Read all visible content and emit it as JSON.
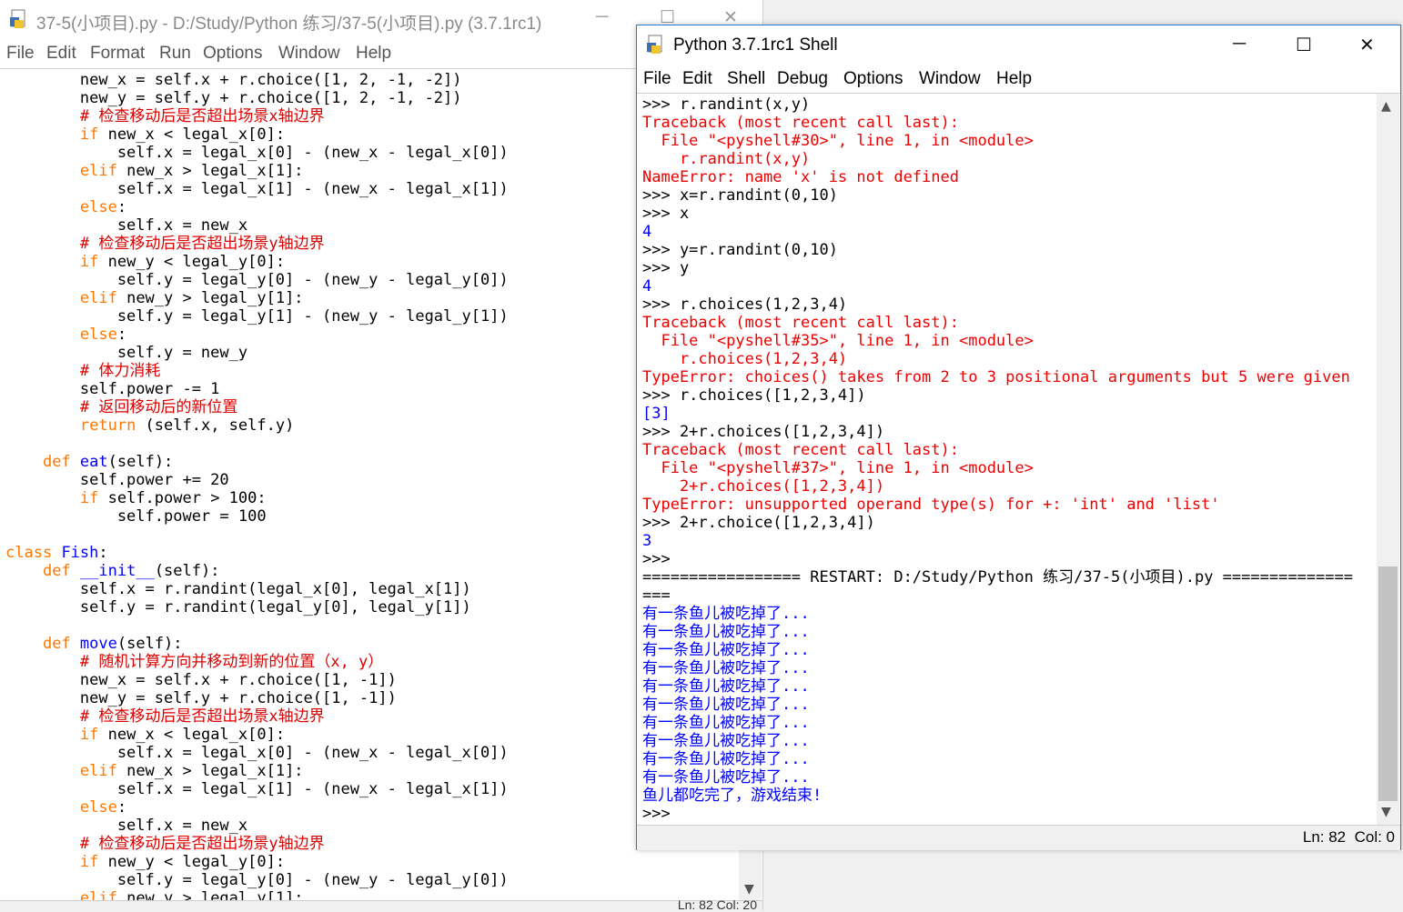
{
  "editor": {
    "title": "37-5(小项目).py - D:/Study/Python 练习/37-5(小项目).py (3.7.1rc1)",
    "menu": [
      "File",
      "Edit",
      "Format",
      "Run",
      "Options",
      "Window",
      "Help"
    ],
    "status": "Ln: 82  Col: 20",
    "code_lines": [
      [
        [
          "        new_x = self.x + r.choice([1, 2, -1, -2])",
          "n"
        ]
      ],
      [
        [
          "        new_y = self.y + r.choice([1, 2, -1, -2])",
          "n"
        ]
      ],
      [
        [
          "        # 检查移动后是否超出场景x轴边界",
          "c"
        ]
      ],
      [
        [
          "        ",
          "n"
        ],
        [
          "if",
          "k"
        ],
        [
          " new_x < legal_x[0]:",
          "n"
        ]
      ],
      [
        [
          "            self.x = legal_x[0] - (new_x - legal_x[0])",
          "n"
        ]
      ],
      [
        [
          "        ",
          "n"
        ],
        [
          "elif",
          "k"
        ],
        [
          " new_x > legal_x[1]:",
          "n"
        ]
      ],
      [
        [
          "            self.x = legal_x[1] - (new_x - legal_x[1])",
          "n"
        ]
      ],
      [
        [
          "        ",
          "n"
        ],
        [
          "else",
          "k"
        ],
        [
          ":",
          "n"
        ]
      ],
      [
        [
          "            self.x = new_x",
          "n"
        ]
      ],
      [
        [
          "        # 检查移动后是否超出场景y轴边界",
          "c"
        ]
      ],
      [
        [
          "        ",
          "n"
        ],
        [
          "if",
          "k"
        ],
        [
          " new_y < legal_y[0]:",
          "n"
        ]
      ],
      [
        [
          "            self.y = legal_y[0] - (new_y - legal_y[0])",
          "n"
        ]
      ],
      [
        [
          "        ",
          "n"
        ],
        [
          "elif",
          "k"
        ],
        [
          " new_y > legal_y[1]:",
          "n"
        ]
      ],
      [
        [
          "            self.y = legal_y[1] - (new_y - legal_y[1])",
          "n"
        ]
      ],
      [
        [
          "        ",
          "n"
        ],
        [
          "else",
          "k"
        ],
        [
          ":",
          "n"
        ]
      ],
      [
        [
          "            self.y = new_y",
          "n"
        ]
      ],
      [
        [
          "        # 体力消耗",
          "c"
        ]
      ],
      [
        [
          "        self.power -= 1",
          "n"
        ]
      ],
      [
        [
          "        # 返回移动后的新位置",
          "c"
        ]
      ],
      [
        [
          "        ",
          "n"
        ],
        [
          "return",
          "k"
        ],
        [
          " (self.x, self.y)",
          "n"
        ]
      ],
      [
        [
          "",
          "n"
        ]
      ],
      [
        [
          "    ",
          "n"
        ],
        [
          "def",
          "k"
        ],
        [
          " ",
          "n"
        ],
        [
          "eat",
          "d"
        ],
        [
          "(self):",
          "n"
        ]
      ],
      [
        [
          "        self.power += 20",
          "n"
        ]
      ],
      [
        [
          "        ",
          "n"
        ],
        [
          "if",
          "k"
        ],
        [
          " self.power > 100:",
          "n"
        ]
      ],
      [
        [
          "            self.power = 100",
          "n"
        ]
      ],
      [
        [
          "",
          "n"
        ]
      ],
      [
        [
          "class",
          "k"
        ],
        [
          " ",
          "n"
        ],
        [
          "Fish",
          "d"
        ],
        [
          ":",
          "n"
        ]
      ],
      [
        [
          "    ",
          "n"
        ],
        [
          "def",
          "k"
        ],
        [
          " ",
          "n"
        ],
        [
          "__init__",
          "d"
        ],
        [
          "(self):",
          "n"
        ]
      ],
      [
        [
          "        self.x = r.randint(legal_x[0], legal_x[1])",
          "n"
        ]
      ],
      [
        [
          "        self.y = r.randint(legal_y[0], legal_y[1])",
          "n"
        ]
      ],
      [
        [
          "",
          "n"
        ]
      ],
      [
        [
          "    ",
          "n"
        ],
        [
          "def",
          "k"
        ],
        [
          " ",
          "n"
        ],
        [
          "move",
          "d"
        ],
        [
          "(self):",
          "n"
        ]
      ],
      [
        [
          "        # 随机计算方向并移动到新的位置（x, y）",
          "c"
        ]
      ],
      [
        [
          "        new_x = self.x + r.choice([1, -1])",
          "n"
        ]
      ],
      [
        [
          "        new_y = self.y + r.choice([1, -1])",
          "n"
        ]
      ],
      [
        [
          "        # 检查移动后是否超出场景x轴边界",
          "c"
        ]
      ],
      [
        [
          "        ",
          "n"
        ],
        [
          "if",
          "k"
        ],
        [
          " new_x < legal_x[0]:",
          "n"
        ]
      ],
      [
        [
          "            self.x = legal_x[0] - (new_x - legal_x[0])",
          "n"
        ]
      ],
      [
        [
          "        ",
          "n"
        ],
        [
          "elif",
          "k"
        ],
        [
          " new_x > legal_x[1]:",
          "n"
        ]
      ],
      [
        [
          "            self.x = legal_x[1] - (new_x - legal_x[1])",
          "n"
        ]
      ],
      [
        [
          "        ",
          "n"
        ],
        [
          "else",
          "k"
        ],
        [
          ":",
          "n"
        ]
      ],
      [
        [
          "            self.x = new_x",
          "n"
        ]
      ],
      [
        [
          "        # 检查移动后是否超出场景y轴边界",
          "c"
        ]
      ],
      [
        [
          "        ",
          "n"
        ],
        [
          "if",
          "k"
        ],
        [
          " new_y < legal_y[0]:",
          "n"
        ]
      ],
      [
        [
          "            self.y = legal_y[0] - (new_y - legal_y[0])",
          "n"
        ]
      ],
      [
        [
          "        ",
          "n"
        ],
        [
          "elif",
          "k"
        ],
        [
          " new_y > legal_y[1]:",
          "n"
        ]
      ]
    ]
  },
  "shell": {
    "title": "Python 3.7.1rc1 Shell",
    "menu": [
      "File",
      "Edit",
      "Shell",
      "Debug",
      "Options",
      "Window",
      "Help"
    ],
    "status": "Ln: 82  Col: 0",
    "lines": [
      [
        [
          ">>> r.randint(x,y)",
          "n"
        ]
      ],
      [
        [
          "Traceback (most recent call last):",
          "e"
        ]
      ],
      [
        [
          "  File \"<pyshell#30>\", line 1, in <module>",
          "e"
        ]
      ],
      [
        [
          "    r.randint(x,y)",
          "e"
        ]
      ],
      [
        [
          "NameError: name 'x' is not defined",
          "e"
        ]
      ],
      [
        [
          ">>> x=r.randint(0,10)",
          "n"
        ]
      ],
      [
        [
          ">>> x",
          "n"
        ]
      ],
      [
        [
          "4",
          "o"
        ]
      ],
      [
        [
          ">>> y=r.randint(0,10)",
          "n"
        ]
      ],
      [
        [
          ">>> y",
          "n"
        ]
      ],
      [
        [
          "4",
          "o"
        ]
      ],
      [
        [
          ">>> r.choices(1,2,3,4)",
          "n"
        ]
      ],
      [
        [
          "Traceback (most recent call last):",
          "e"
        ]
      ],
      [
        [
          "  File \"<pyshell#35>\", line 1, in <module>",
          "e"
        ]
      ],
      [
        [
          "    r.choices(1,2,3,4)",
          "e"
        ]
      ],
      [
        [
          "TypeError: choices() takes from 2 to 3 positional arguments but 5 were given",
          "e"
        ]
      ],
      [
        [
          ">>> r.choices([1,2,3,4])",
          "n"
        ]
      ],
      [
        [
          "[3]",
          "o"
        ]
      ],
      [
        [
          ">>> 2+r.choices([1,2,3,4])",
          "n"
        ]
      ],
      [
        [
          "Traceback (most recent call last):",
          "e"
        ]
      ],
      [
        [
          "  File \"<pyshell#37>\", line 1, in <module>",
          "e"
        ]
      ],
      [
        [
          "    2+r.choices([1,2,3,4])",
          "e"
        ]
      ],
      [
        [
          "TypeError: unsupported operand type(s) for +: 'int' and 'list'",
          "e"
        ]
      ],
      [
        [
          ">>> 2+r.choice([1,2,3,4])",
          "n"
        ]
      ],
      [
        [
          "3",
          "o"
        ]
      ],
      [
        [
          ">>> ",
          "n"
        ]
      ],
      [
        [
          "================= RESTART: D:/Study/Python 练习/37-5(小项目).py ==============",
          "n"
        ]
      ],
      [
        [
          "===",
          "n"
        ]
      ],
      [
        [
          "有一条鱼儿被吃掉了...",
          "o"
        ]
      ],
      [
        [
          "有一条鱼儿被吃掉了...",
          "o"
        ]
      ],
      [
        [
          "有一条鱼儿被吃掉了...",
          "o"
        ]
      ],
      [
        [
          "有一条鱼儿被吃掉了...",
          "o"
        ]
      ],
      [
        [
          "有一条鱼儿被吃掉了...",
          "o"
        ]
      ],
      [
        [
          "有一条鱼儿被吃掉了...",
          "o"
        ]
      ],
      [
        [
          "有一条鱼儿被吃掉了...",
          "o"
        ]
      ],
      [
        [
          "有一条鱼儿被吃掉了...",
          "o"
        ]
      ],
      [
        [
          "有一条鱼儿被吃掉了...",
          "o"
        ]
      ],
      [
        [
          "有一条鱼儿被吃掉了...",
          "o"
        ]
      ],
      [
        [
          "鱼儿都吃完了，游戏结束!",
          "o"
        ]
      ],
      [
        [
          ">>> ",
          "n"
        ]
      ]
    ]
  }
}
